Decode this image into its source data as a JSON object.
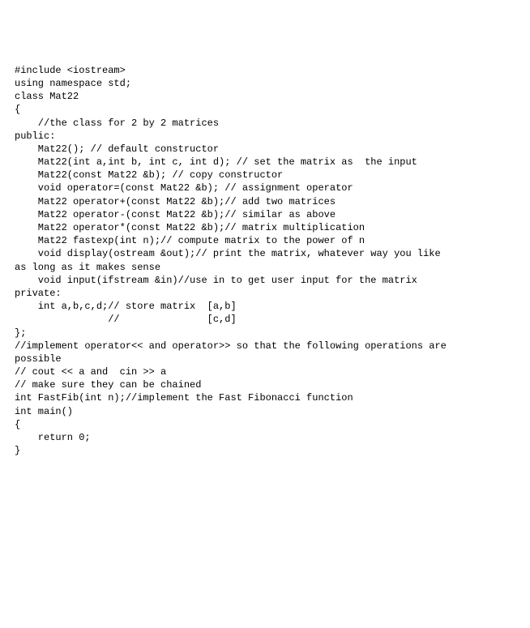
{
  "code": {
    "lines": [
      "#include <iostream>",
      "using namespace std;",
      "",
      "",
      "",
      "class Mat22",
      "{",
      "    //the class for 2 by 2 matrices",
      "public:",
      "",
      "    Mat22(); // default constructor",
      "",
      "    Mat22(int a,int b, int c, int d); // set the matrix as  the input",
      "    Mat22(const Mat22 &b); // copy constructor",
      "",
      "",
      "    void operator=(const Mat22 &b); // assignment operator",
      "    Mat22 operator+(const Mat22 &b);// add two matrices",
      "    Mat22 operator-(const Mat22 &b);// similar as above",
      "    Mat22 operator*(const Mat22 &b);// matrix multiplication",
      "",
      "    Mat22 fastexp(int n);// compute matrix to the power of n",
      "    void display(ostream &out);// print the matrix, whatever way you like",
      "as long as it makes sense",
      "    void input(ifstream &in)//use in to get user input for the matrix",
      "",
      "private:",
      "",
      "    int a,b,c,d;// store matrix  [a,b]",
      "                //               [c,d]",
      "",
      "",
      "};",
      "",
      "",
      "//implement operator<< and operator>> so that the following operations are",
      "possible",
      "// cout << a and  cin >> a",
      "// make sure they can be chained",
      "",
      "int FastFib(int n);//implement the Fast Fibonacci function",
      "",
      "",
      "int main()",
      "{",
      "",
      "    return 0;",
      "}"
    ]
  }
}
